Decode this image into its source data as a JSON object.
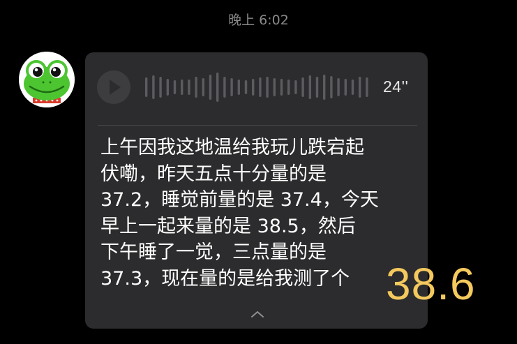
{
  "timestamp": "晚上 6:02",
  "contact": {
    "avatar_icon": "frog-avatar"
  },
  "message": {
    "type": "voice",
    "duration": "24''",
    "transcript": "上午因我这地温给我玩儿跌宕起\n伏嘞，昨天五点十分量的是\n37.2，睡觉前量的是 37.4，今天\n早上一起来量的是 38.5，然后\n下午睡了一觉，三点量的是\n37.3，现在量的是给我测了个",
    "play_icon": "play-icon",
    "waveform_icon": "waveform-icon",
    "collapse_icon": "chevron-up-icon"
  },
  "overlay": {
    "value": "38.6",
    "color": "#f4c95d"
  },
  "colors": {
    "background": "#000000",
    "bubble": "#2c2c2e",
    "timestamp": "#8a8a8a"
  }
}
